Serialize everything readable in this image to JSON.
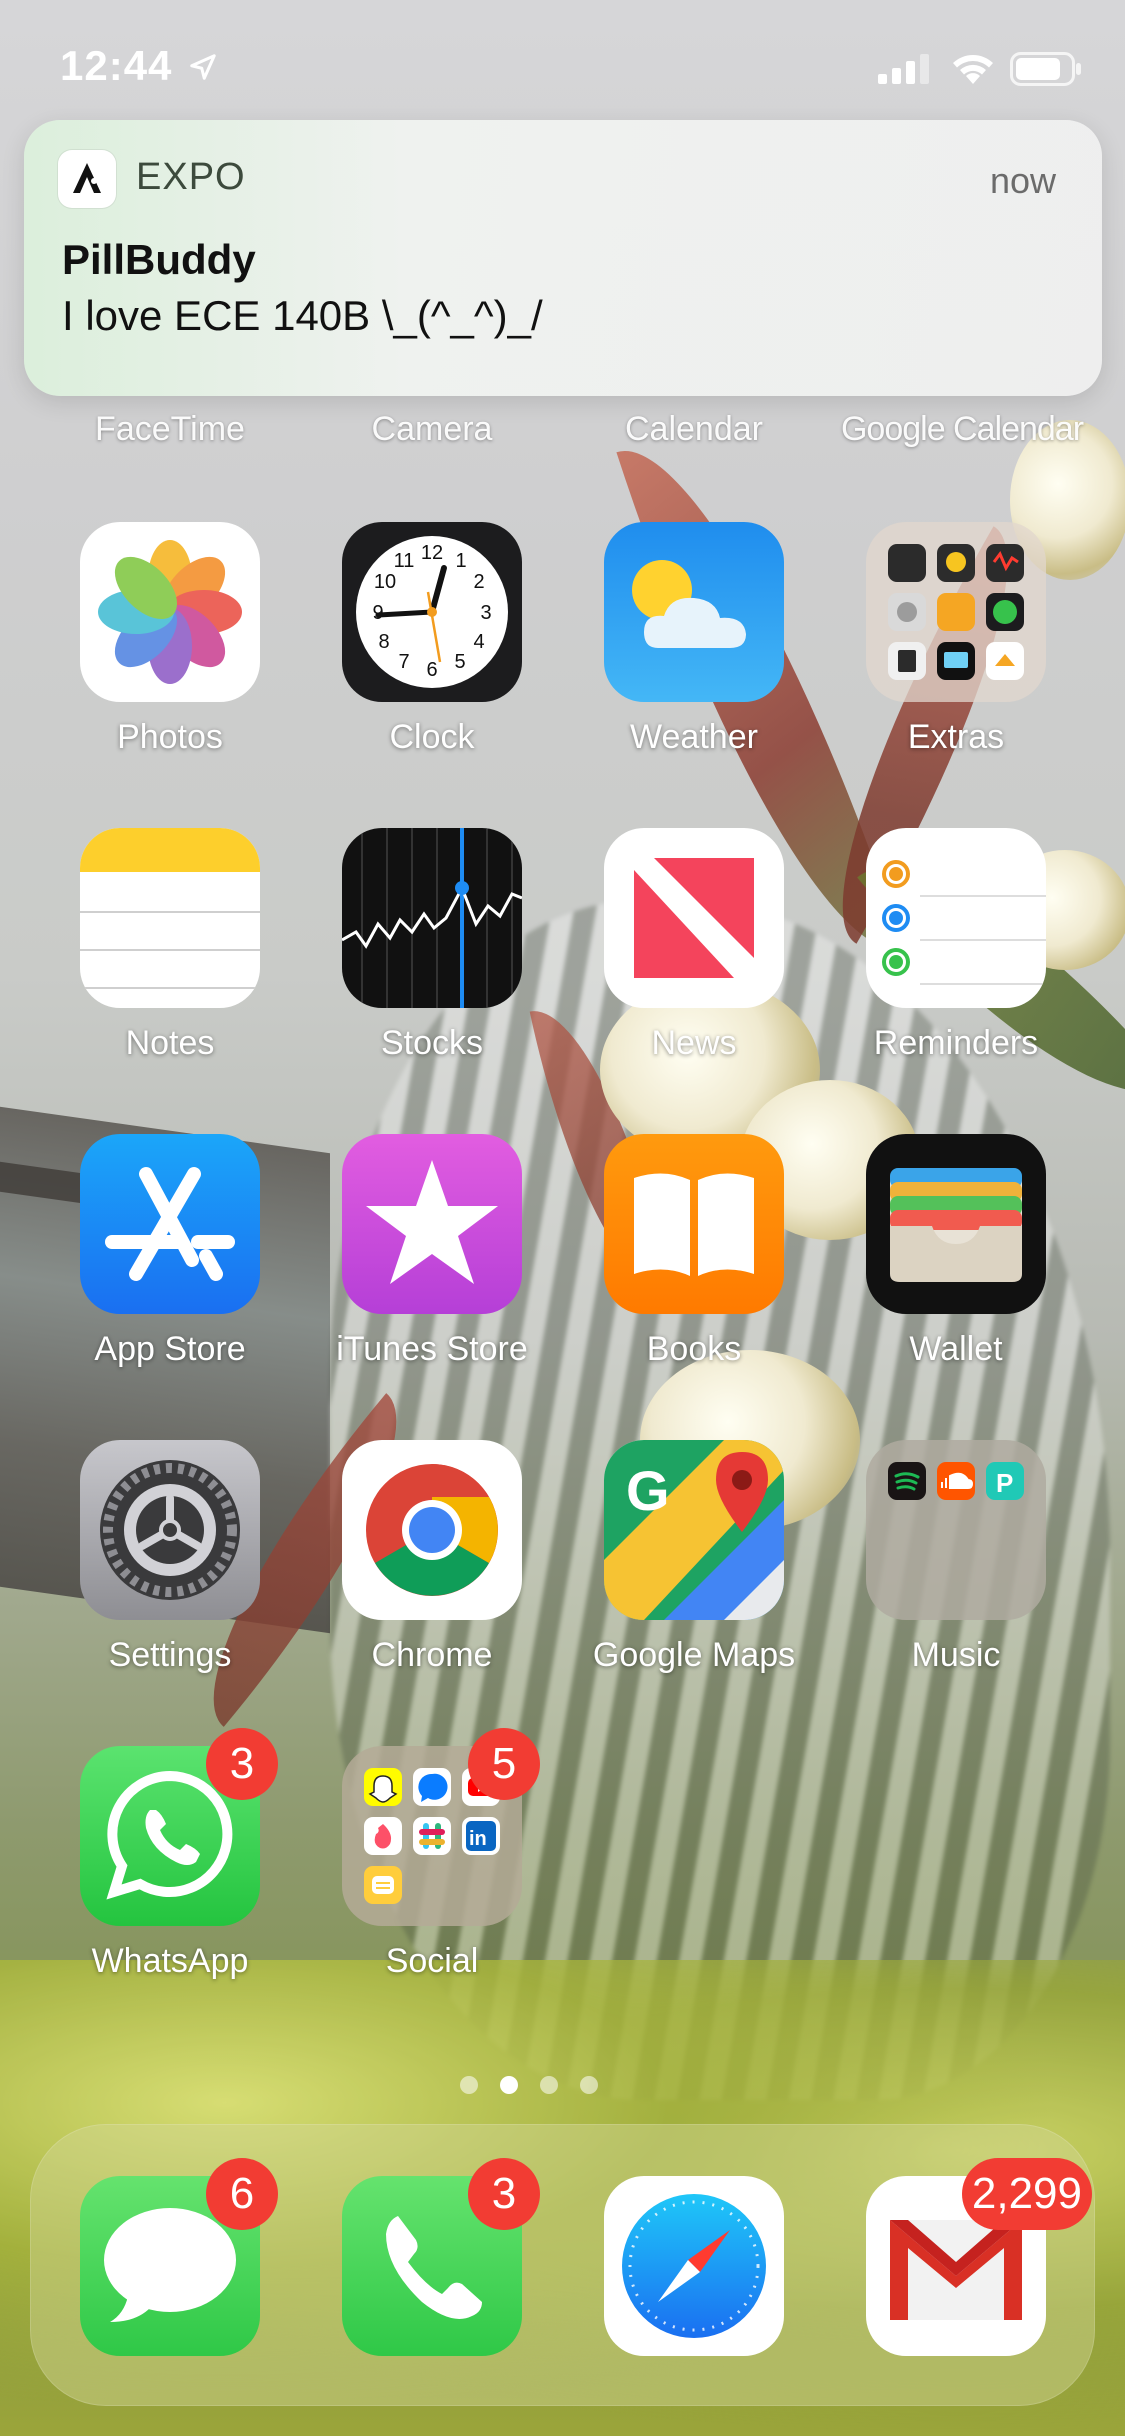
{
  "status_bar": {
    "time": "12:44",
    "icons": [
      "location-arrow-icon",
      "cellular-signal-icon",
      "wifi-icon",
      "battery-icon"
    ]
  },
  "notification": {
    "app_name": "EXPO",
    "time": "now",
    "title": "PillBuddy",
    "body": "I love ECE 140B \\_(^_^)_/"
  },
  "row0_labels": [
    "FaceTime",
    "Camera",
    "Calendar",
    "Google Calendar"
  ],
  "apps": {
    "photos": "Photos",
    "clock": "Clock",
    "weather": "Weather",
    "extras": "Extras",
    "notes": "Notes",
    "stocks": "Stocks",
    "news": "News",
    "reminders": "Reminders",
    "app_store": "App Store",
    "itunes": "iTunes Store",
    "books": "Books",
    "wallet": "Wallet",
    "settings": "Settings",
    "chrome": "Chrome",
    "maps": "Google Maps",
    "music": "Music",
    "whatsapp": "WhatsApp",
    "social": "Social"
  },
  "badges": {
    "whatsapp": "3",
    "social": "5",
    "messages": "6",
    "phone": "3",
    "gmail": "2,299"
  },
  "clock_numbers": [
    "12",
    "1",
    "2",
    "3",
    "4",
    "5",
    "6",
    "7",
    "8",
    "9",
    "10",
    "11"
  ],
  "page_dots": {
    "count": 4,
    "active_index": 1
  },
  "dock": [
    "Messages",
    "Phone",
    "Safari",
    "Gmail"
  ],
  "colors": {
    "badge": "#f23c33",
    "notification_bg": "#f0f0f0"
  }
}
